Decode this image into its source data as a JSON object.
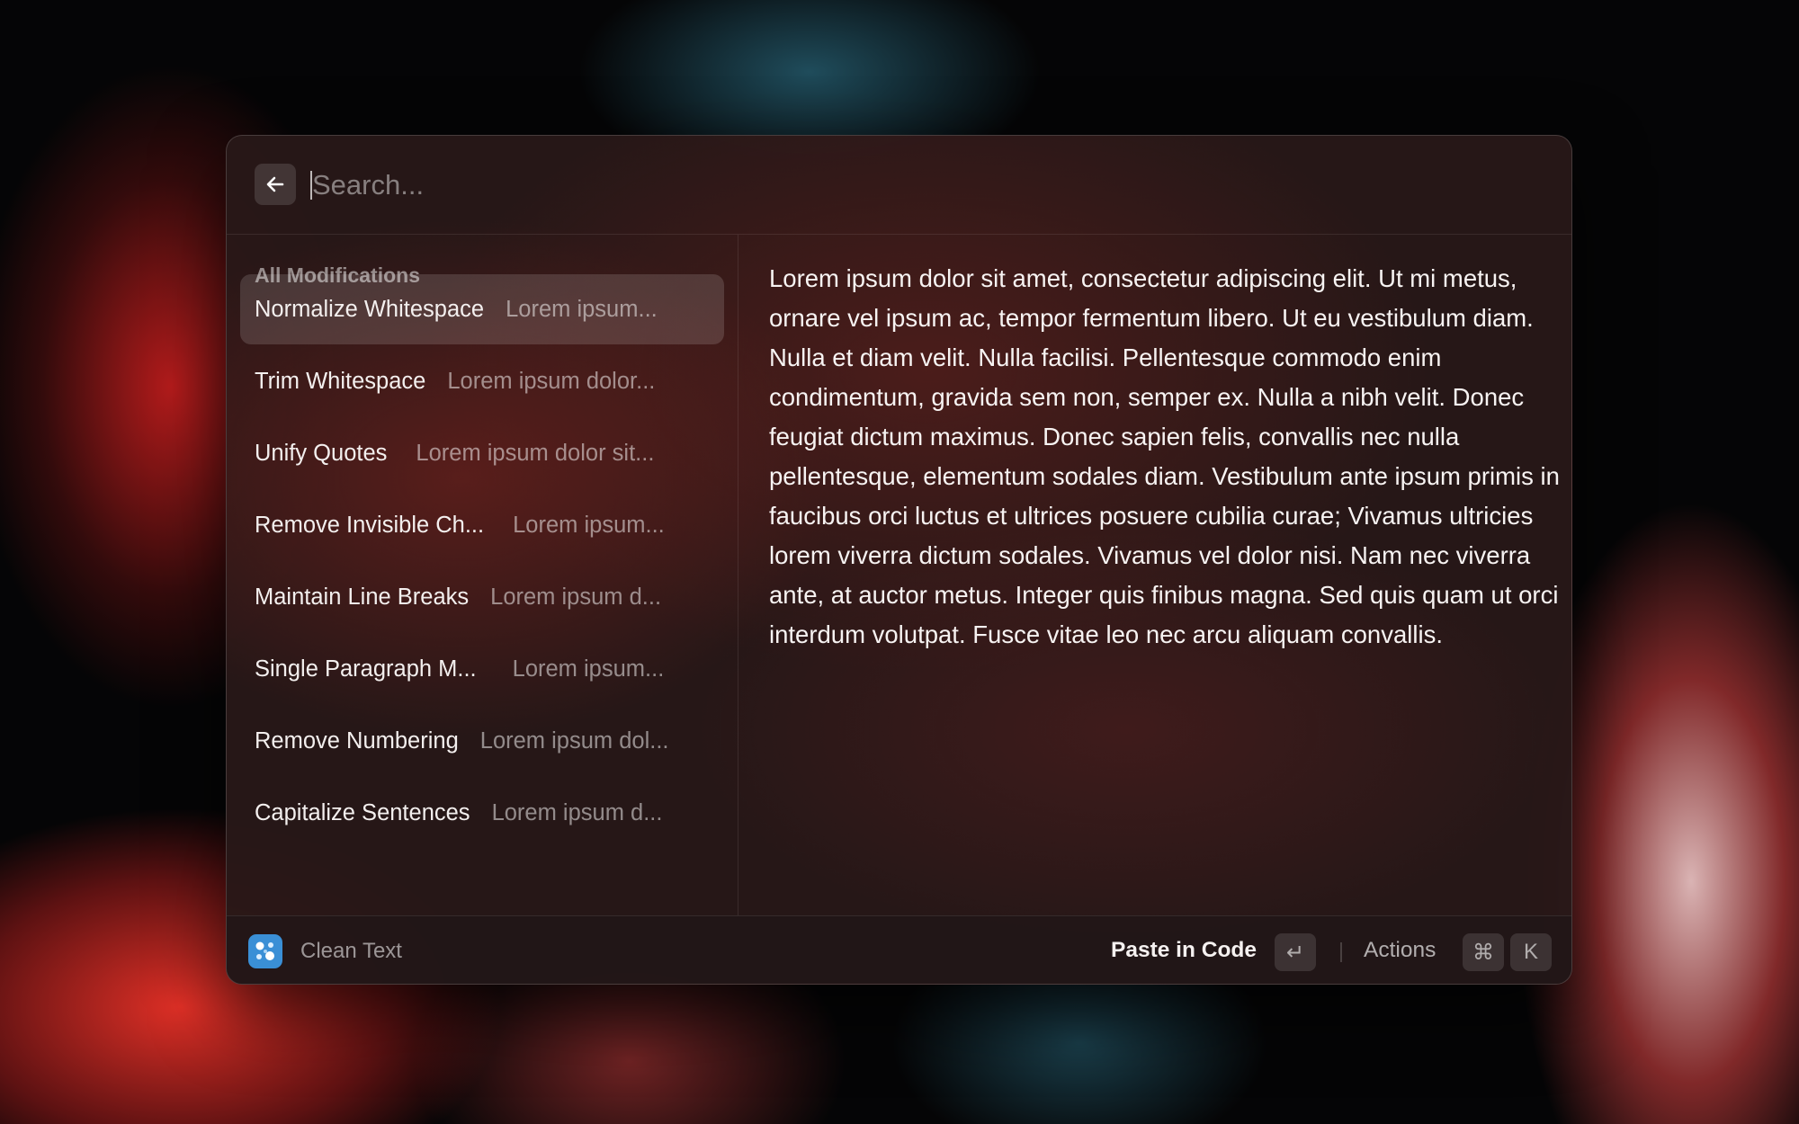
{
  "search": {
    "placeholder": "Search..."
  },
  "list": {
    "section_title": "All Modifications",
    "items": [
      {
        "title": "Normalize Whitespace",
        "subtitle": "Lorem ipsum..."
      },
      {
        "title": "Trim Whitespace",
        "subtitle": "Lorem ipsum dolor..."
      },
      {
        "title": "Unify Quotes",
        "subtitle": "Lorem ipsum dolor sit..."
      },
      {
        "title": "Remove Invisible Ch...",
        "subtitle": "Lorem ipsum..."
      },
      {
        "title": "Maintain Line Breaks",
        "subtitle": "Lorem ipsum d..."
      },
      {
        "title": "Single Paragraph M...",
        "subtitle": "Lorem ipsum..."
      },
      {
        "title": "Remove Numbering",
        "subtitle": "Lorem ipsum dol..."
      },
      {
        "title": "Capitalize Sentences",
        "subtitle": "Lorem ipsum d..."
      }
    ]
  },
  "detail": {
    "text": "Lorem ipsum dolor sit amet, consectetur adipiscing elit. Ut mi metus, ornare vel ipsum ac, tempor fermentum libero. Ut eu vestibulum diam. Nulla et diam velit. Nulla facilisi. Pellentesque commodo enim condimentum, gravida sem non, semper ex. Nulla a nibh velit. Donec feugiat dictum maximus. Donec sapien felis, convallis nec nulla pellentesque, elementum sodales diam. Vestibulum ante ipsum primis in faucibus orci luctus et ultrices posuere cubilia curae; Vivamus ultricies lorem viverra dictum sodales. Vivamus vel dolor nisi. Nam nec viverra ante, at auctor metus. Integer quis finibus magna. Sed quis quam ut orci interdum volutpat. Fusce vitae leo nec arcu aliquam convallis."
  },
  "footer": {
    "app_name": "Clean Text",
    "primary_action": "Paste in Code",
    "primary_key": "↵",
    "actions_label": "Actions",
    "actions_keys": [
      "⌘",
      "K"
    ]
  },
  "colors": {
    "app_icon": "#3a8fd6",
    "selected_item_bg": "rgba(255,255,255,0.14)"
  },
  "icons": {
    "back": "arrow-left-icon",
    "app": "clean-text-app-icon"
  }
}
